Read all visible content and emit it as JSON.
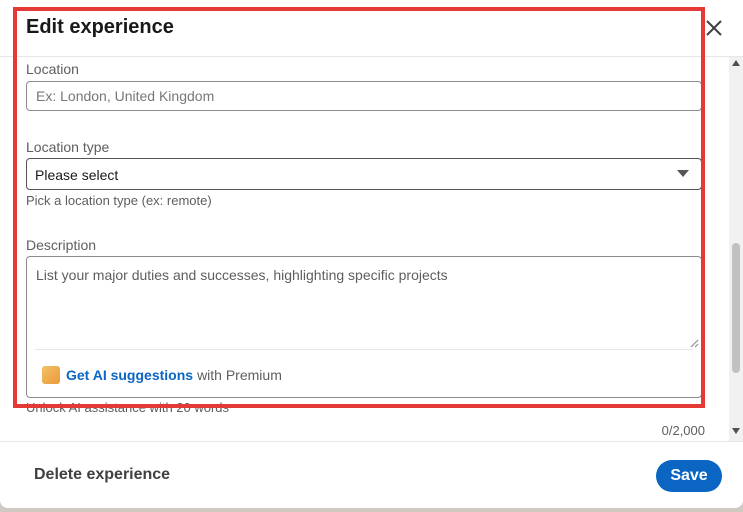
{
  "dialog": {
    "title": "Edit experience",
    "close_icon": "close-icon"
  },
  "form": {
    "location": {
      "label": "Location",
      "placeholder": "Ex: London, United Kingdom",
      "value": ""
    },
    "location_type": {
      "label": "Location type",
      "selected": "Please select",
      "hint": "Pick a location type (ex: remote)"
    },
    "description": {
      "label": "Description",
      "placeholder": "List your major duties and successes, highlighting specific projects",
      "ai_link": "Get AI suggestions",
      "ai_suffix": "with Premium",
      "unlock_text": "Unlock AI assistance with 20 words",
      "counter": "0/2,000"
    }
  },
  "footer": {
    "delete_label": "Delete experience",
    "save_label": "Save"
  },
  "colors": {
    "accent": "#0a66c2",
    "highlight": "#e53935"
  }
}
